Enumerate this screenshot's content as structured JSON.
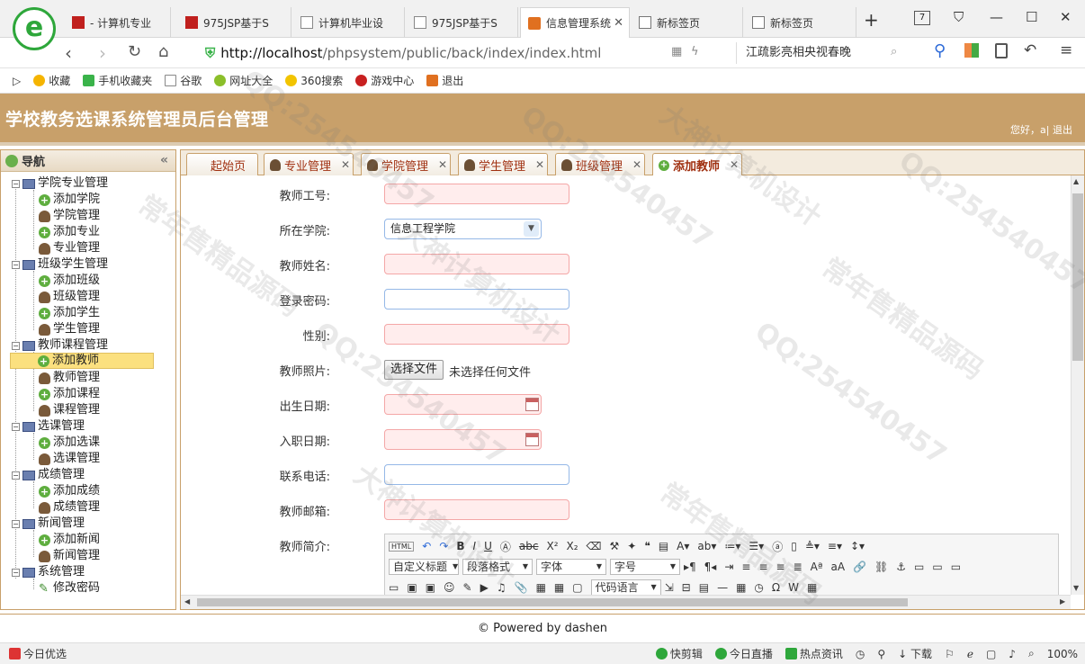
{
  "browser": {
    "tabs": [
      {
        "title": "- 计算机专业"
      },
      {
        "title": "975JSP基于S"
      },
      {
        "title": "计算机毕业设"
      },
      {
        "title": "975JSP基于S"
      },
      {
        "title": "信息管理系统"
      },
      {
        "title": "新标签页"
      },
      {
        "title": "新标签页"
      }
    ],
    "tab_count_badge": "7",
    "url_host": "http://localhost",
    "url_path": "/phpsystem/public/back/index/index.html",
    "search_text": "江疏影亮相央视春晚",
    "bookmarks": [
      "收藏",
      "手机收藏夹",
      "谷歌",
      "网址大全",
      "360搜索",
      "游戏中心",
      "退出"
    ]
  },
  "app": {
    "title": "学校教务选课系统管理员后台管理",
    "greeting": "您好，a| 退出"
  },
  "sidebar": {
    "title": "导航",
    "groups": [
      {
        "label": "学院专业管理",
        "items": [
          "添加学院",
          "学院管理",
          "添加专业",
          "专业管理"
        ]
      },
      {
        "label": "班级学生管理",
        "items": [
          "添加班级",
          "班级管理",
          "添加学生",
          "学生管理"
        ]
      },
      {
        "label": "教师课程管理",
        "items": [
          "添加教师",
          "教师管理",
          "添加课程",
          "课程管理"
        ]
      },
      {
        "label": "选课管理",
        "items": [
          "添加选课",
          "选课管理"
        ]
      },
      {
        "label": "成绩管理",
        "items": [
          "添加成绩",
          "成绩管理"
        ]
      },
      {
        "label": "新闻管理",
        "items": [
          "添加新闻",
          "新闻管理"
        ]
      },
      {
        "label": "系统管理",
        "items": [
          "修改密码"
        ]
      }
    ],
    "selected": "添加教师"
  },
  "page_tabs": [
    "起始页",
    "专业管理",
    "学院管理",
    "学生管理",
    "班级管理",
    "添加教师"
  ],
  "form": {
    "teacher_no": "教师工号:",
    "college": "所在学院:",
    "college_value": "信息工程学院",
    "name": "教师姓名:",
    "password": "登录密码:",
    "gender": "性别:",
    "photo": "教师照片:",
    "file_button": "选择文件",
    "file_status": "未选择任何文件",
    "birth": "出生日期:",
    "join_date": "入职日期:",
    "phone": "联系电话:",
    "email": "教师邮箱:",
    "intro": "教师简介:"
  },
  "editor": {
    "html_btn": "HTML",
    "heading_select": "自定义标题",
    "para_select": "段落格式",
    "font_select": "字体",
    "size_select": "字号",
    "code_select": "代码语言"
  },
  "footer": "© Powered by dashen",
  "statusbar": {
    "left": "今日优选",
    "items": [
      "快剪辑",
      "今日直播",
      "热点资讯",
      "下载"
    ],
    "zoom": "100%"
  },
  "watermarks": [
    "QQ:254540457",
    "常年售精品源码",
    "大神计算机设计"
  ]
}
